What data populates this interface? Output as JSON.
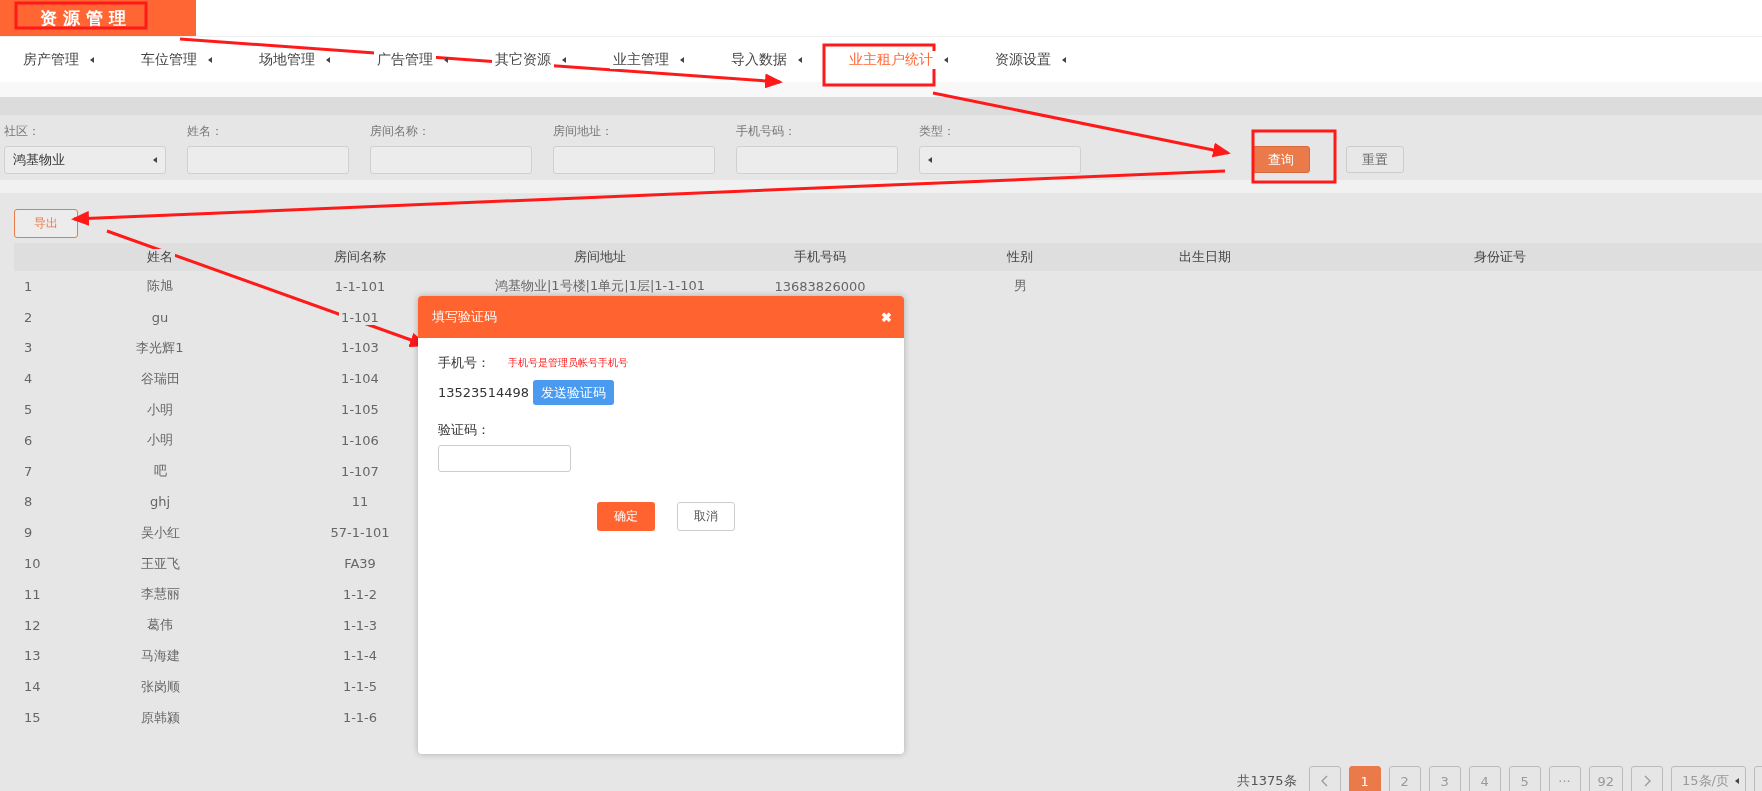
{
  "header": {
    "title": "资源管理"
  },
  "nav": [
    {
      "label": "房产管理",
      "selected": false
    },
    {
      "label": "车位管理",
      "selected": false
    },
    {
      "label": "场地管理",
      "selected": false
    },
    {
      "label": "广告管理",
      "selected": false
    },
    {
      "label": "其它资源",
      "selected": false
    },
    {
      "label": "业主管理",
      "selected": false
    },
    {
      "label": "导入数据",
      "selected": false
    },
    {
      "label": "业主租户统计",
      "selected": true
    },
    {
      "label": "资源设置",
      "selected": false
    }
  ],
  "filters": [
    {
      "label": "社区：",
      "kind": "select",
      "value": "鸿基物业"
    },
    {
      "label": "姓名：",
      "kind": "text"
    },
    {
      "label": "房间名称：",
      "kind": "text"
    },
    {
      "label": "房间地址：",
      "kind": "text"
    },
    {
      "label": "手机号码：",
      "kind": "text"
    },
    {
      "label": "类型：",
      "kind": "select"
    }
  ],
  "buttons": {
    "query": "查询",
    "reset": "重置",
    "export": "导出"
  },
  "table": {
    "columns": [
      "姓名",
      "房间名称",
      "房间地址",
      "手机号码",
      "性别",
      "出生日期",
      "身份证号"
    ],
    "rows": [
      {
        "index": "1",
        "name": "陈旭",
        "room": "1-1-101",
        "address": "鸿基物业|1号楼|1单元|1层|1-1-101",
        "phone": "13683826000",
        "gender": "男"
      },
      {
        "index": "2",
        "name": "gu",
        "room": "1-101"
      },
      {
        "index": "3",
        "name": "李光辉1",
        "room": "1-103"
      },
      {
        "index": "4",
        "name": "谷瑞田",
        "room": "1-104"
      },
      {
        "index": "5",
        "name": "小明",
        "room": "1-105"
      },
      {
        "index": "6",
        "name": "小明",
        "room": "1-106"
      },
      {
        "index": "7",
        "name": "吧",
        "room": "1-107"
      },
      {
        "index": "8",
        "name": "ghj",
        "room": "11"
      },
      {
        "index": "9",
        "name": "吴小红",
        "room": "57-1-101"
      },
      {
        "index": "10",
        "name": "王亚飞",
        "room": "FA39"
      },
      {
        "index": "11",
        "name": "李慧丽",
        "room": "1-1-2"
      },
      {
        "index": "12",
        "name": "葛伟",
        "room": "1-1-3"
      },
      {
        "index": "13",
        "name": "马海建",
        "room": "1-1-4"
      },
      {
        "index": "14",
        "name": "张岗顺",
        "room": "1-1-5"
      },
      {
        "index": "15",
        "name": "原韩颍",
        "room": "1-1-6"
      }
    ]
  },
  "dialog": {
    "title": "填写验证码",
    "close": "✖",
    "phone_label": "手机号：",
    "phone_note": "手机号是管理员帐号手机号",
    "phone": "13523514498",
    "send_button": "发送验证码",
    "code_label": "验证码：",
    "confirm": "确定",
    "cancel": "取消"
  },
  "pagination": {
    "total": "共1375条",
    "pages": [
      {
        "label": "1",
        "selected": true
      },
      {
        "label": "2",
        "selected": false
      },
      {
        "label": "3",
        "selected": false
      },
      {
        "label": "4",
        "selected": false
      },
      {
        "label": "5",
        "selected": false
      },
      {
        "label": "···",
        "selected": false
      },
      {
        "label": "92",
        "selected": false
      }
    ],
    "page_size": "15条/页"
  }
}
